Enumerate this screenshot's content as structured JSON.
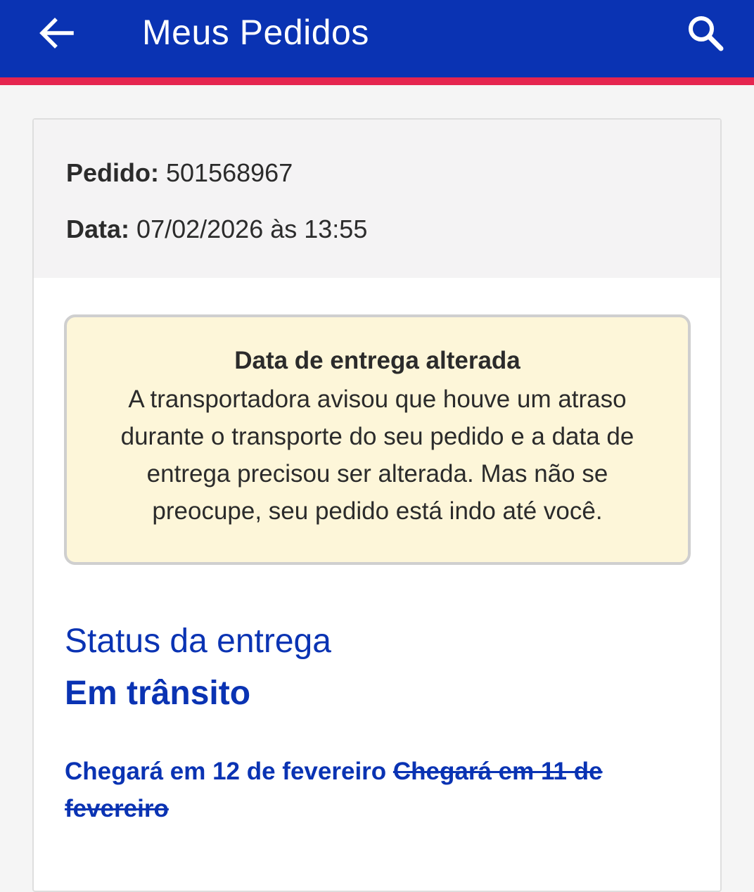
{
  "appbar": {
    "title": "Meus Pedidos",
    "back_icon": "arrow-left-icon",
    "search_icon": "search-icon",
    "background_color": "#0a33b3",
    "stripe_color": "#e5254f"
  },
  "order": {
    "number_label": "Pedido:",
    "number_value": "501568967",
    "date_label": "Data:",
    "date_value": "07/02/2026 às 13:55"
  },
  "notice": {
    "title": "Data de entrega alterada",
    "text": "A transportadora avisou que houve um atraso durante o transporte do seu pedido e a data de entrega precisou ser alterada. Mas não se preocupe, seu pedido está indo até você.",
    "background_color": "#fdf6d9"
  },
  "delivery": {
    "status_label": "Status da entrega",
    "status_value": "Em trânsito",
    "new_arrival": "Chegará em 12 de fevereiro",
    "old_arrival": "Chegará em 11 de fevereiro",
    "accent_color": "#0a33b3"
  }
}
